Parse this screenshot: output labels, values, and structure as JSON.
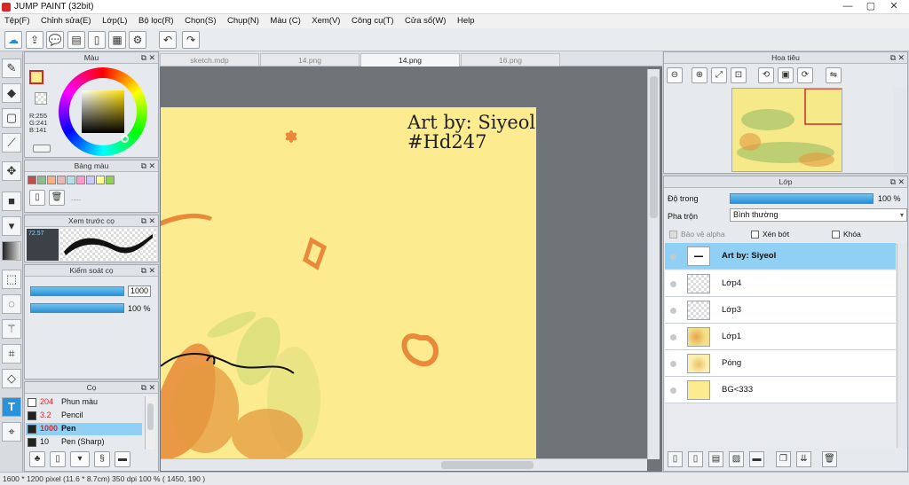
{
  "window": {
    "title": "JUMP PAINT (32bit)",
    "controls": [
      "—",
      "▢",
      "✕"
    ]
  },
  "menu": [
    "Tệp(F)",
    "Chỉnh sửa(E)",
    "Lớp(L)",
    "Bộ lọc(R)",
    "Chọn(S)",
    "Chụp(N)",
    "Màu (C)",
    "Xem(V)",
    "Công cụ(T)",
    "Cửa sổ(W)",
    "Help"
  ],
  "panels": {
    "color": {
      "title": "Màu",
      "r": "R:255",
      "g": "G:241",
      "b": "B:141",
      "fg": "#fdeb8d"
    },
    "palette": {
      "title": "Bảng màu",
      "colors": [
        "#c0504d",
        "#8fbc8f",
        "#f4b183",
        "#e6b8b7",
        "#b7dde8",
        "#ff99cc",
        "#c9c9ff",
        "#ffff99",
        "#92d050"
      ],
      "ellipsis": "....."
    },
    "brush_preview": {
      "title": "Xem trước cọ",
      "size": "72.57"
    },
    "brush_control": {
      "title": "Kiểm soát cọ",
      "size_value": "1000",
      "opacity_value": "100 %"
    },
    "brushes": {
      "title": "Cọ",
      "items": [
        {
          "num": "204",
          "label": "Phun màu",
          "selected": false
        },
        {
          "num": "3.2",
          "label": "Pencil",
          "selected": false
        },
        {
          "num": "1000",
          "label": "Pen",
          "selected": true
        },
        {
          "num": "10",
          "label": "Pen (Sharp)",
          "selected": false
        }
      ]
    },
    "navigator": {
      "title": "Hoa tiêu"
    },
    "layers": {
      "title": "Lớp",
      "opacity_label": "Độ trong",
      "opacity_value": "100 %",
      "opacity": 1.0,
      "blend_label": "Pha trộn",
      "blend_value": "Bình thường",
      "protect_alpha": "Bảo vệ alpha",
      "clipping": "Xén bớt",
      "lock": "Khóa",
      "items": [
        {
          "name": "Art by: Siyeol",
          "selected": true,
          "thumb": "text"
        },
        {
          "name": "Lớp4",
          "selected": false,
          "thumb": "empty"
        },
        {
          "name": "Lớp3",
          "selected": false,
          "thumb": "empty"
        },
        {
          "name": "Lớp1",
          "selected": false,
          "thumb": "art"
        },
        {
          "name": "Póng",
          "selected": false,
          "thumb": "art"
        },
        {
          "name": "BG<333",
          "selected": false,
          "thumb": "yellow"
        }
      ]
    }
  },
  "tabs": [
    {
      "label": "sketch.mdp",
      "active": false
    },
    {
      "label": "14.png",
      "active": false
    },
    {
      "label": "14.png",
      "active": true
    },
    {
      "label": "16.png",
      "active": false
    }
  ],
  "canvas": {
    "line1": "Art by: Siyeol",
    "line2": "#Hd247",
    "bg": "#fdeb8f",
    "accent": "#e88a3a"
  },
  "status": "1600 * 1200 pixel   (11.6 * 8.7cm)   350 dpi   100 %   ( 1450, 190 )"
}
